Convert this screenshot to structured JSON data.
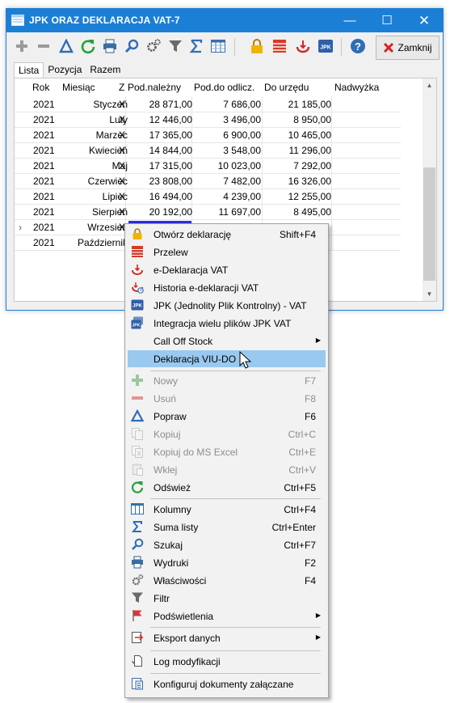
{
  "window": {
    "title": "JPK ORAZ DEKLARACJA VAT-7",
    "controls": {
      "minimize": "—",
      "maximize": "☐",
      "close": "✕"
    }
  },
  "toolbar": {
    "icons": [
      "add-icon",
      "remove-icon",
      "edit-icon",
      "refresh-icon",
      "print-icon",
      "search-icon",
      "settings-icon",
      "filter-icon",
      "sum-icon",
      "columns-icon",
      "lock-icon",
      "transfer-icon",
      "e-declaration-icon",
      "jpk-icon",
      "help-icon"
    ],
    "close_label": "Zamknij",
    "jpk_text": "JPK",
    "help_text": "?"
  },
  "tabs": [
    "Lista",
    "Pozycja",
    "Razem"
  ],
  "table": {
    "columns": [
      "Rok",
      "Miesiąc",
      "Z",
      "Pod.należny",
      "Pod.do odlicz.",
      "Do urzędu",
      "Nadwyżka"
    ],
    "rows": [
      {
        "marker": "",
        "rok": "2021",
        "miesiac": "Styczeń",
        "z": "X",
        "nalezny": "28 871,00",
        "odlicz": "7 686,00",
        "urzad": "21 185,00",
        "nadwyzka": ""
      },
      {
        "marker": "",
        "rok": "2021",
        "miesiac": "Luty",
        "z": "X",
        "nalezny": "12 446,00",
        "odlicz": "3 496,00",
        "urzad": "8 950,00",
        "nadwyzka": ""
      },
      {
        "marker": "",
        "rok": "2021",
        "miesiac": "Marzec",
        "z": "X",
        "nalezny": "17 365,00",
        "odlicz": "6 900,00",
        "urzad": "10 465,00",
        "nadwyzka": ""
      },
      {
        "marker": "",
        "rok": "2021",
        "miesiac": "Kwiecień",
        "z": "X",
        "nalezny": "14 844,00",
        "odlicz": "3 548,00",
        "urzad": "11 296,00",
        "nadwyzka": ""
      },
      {
        "marker": "",
        "rok": "2021",
        "miesiac": "Maj",
        "z": "X",
        "nalezny": "17 315,00",
        "odlicz": "10 023,00",
        "urzad": "7 292,00",
        "nadwyzka": ""
      },
      {
        "marker": "",
        "rok": "2021",
        "miesiac": "Czerwiec",
        "z": "X",
        "nalezny": "23 808,00",
        "odlicz": "7 482,00",
        "urzad": "16 326,00",
        "nadwyzka": ""
      },
      {
        "marker": "",
        "rok": "2021",
        "miesiac": "Lipiec",
        "z": "X",
        "nalezny": "16 494,00",
        "odlicz": "4 239,00",
        "urzad": "12 255,00",
        "nadwyzka": ""
      },
      {
        "marker": "",
        "rok": "2021",
        "miesiac": "Sierpień",
        "z": "X",
        "nalezny": "20 192,00",
        "odlicz": "11 697,00",
        "urzad": "8 495,00",
        "nadwyzka": ""
      },
      {
        "marker": "›",
        "rok": "2021",
        "miesiac": "Wrzesień",
        "z": "X",
        "nalezny": "",
        "odlicz": "",
        "urzad": "",
        "nadwyzka": ""
      },
      {
        "marker": "",
        "rok": "2021",
        "miesiac": "Październik",
        "z": "",
        "nalezny": "",
        "odlicz": "",
        "urzad": "",
        "nadwyzka": ""
      }
    ]
  },
  "context_menu": {
    "items": [
      {
        "label": "Otwórz deklarację",
        "shortcut": "Shift+F4",
        "icon": "lock-icon",
        "disabled": false
      },
      {
        "label": "Przelew",
        "shortcut": "",
        "icon": "transfer-icon",
        "disabled": false
      },
      {
        "label": "e-Deklaracja VAT",
        "shortcut": "",
        "icon": "e-declaration-icon",
        "disabled": false
      },
      {
        "label": "Historia e-deklaracji VAT",
        "shortcut": "",
        "icon": "e-declaration-history-icon",
        "disabled": false
      },
      {
        "label": "JPK (Jednolity Plik Kontrolny) - VAT",
        "shortcut": "",
        "icon": "jpk-icon",
        "disabled": false
      },
      {
        "label": "Integracja wielu plików JPK VAT",
        "shortcut": "",
        "icon": "jpk-integration-icon",
        "disabled": false
      },
      {
        "label": "Call Off Stock",
        "shortcut": "",
        "icon": "",
        "disabled": false,
        "submenu": true
      },
      {
        "label": "Deklaracja VIU-DO",
        "shortcut": "",
        "icon": "",
        "disabled": false,
        "highlighted": true
      },
      {
        "label": "Nowy",
        "shortcut": "F7",
        "icon": "add-icon",
        "disabled": true
      },
      {
        "label": "Usuń",
        "shortcut": "F8",
        "icon": "remove-icon",
        "disabled": true
      },
      {
        "label": "Popraw",
        "shortcut": "F6",
        "icon": "edit-icon",
        "disabled": false
      },
      {
        "label": "Kopiuj",
        "shortcut": "Ctrl+C",
        "icon": "copy-icon",
        "disabled": true
      },
      {
        "label": "Kopiuj do MS Excel",
        "shortcut": "Ctrl+E",
        "icon": "copy-excel-icon",
        "disabled": true
      },
      {
        "label": "Wklej",
        "shortcut": "Ctrl+V",
        "icon": "paste-icon",
        "disabled": true
      },
      {
        "label": "Odśwież",
        "shortcut": "Ctrl+F5",
        "icon": "refresh-icon",
        "disabled": false
      },
      {
        "label": "Kolumny",
        "shortcut": "Ctrl+F4",
        "icon": "columns-icon",
        "disabled": false
      },
      {
        "label": "Suma listy",
        "shortcut": "Ctrl+Enter",
        "icon": "sum-icon",
        "disabled": false
      },
      {
        "label": "Szukaj",
        "shortcut": "Ctrl+F7",
        "icon": "search-icon",
        "disabled": false
      },
      {
        "label": "Wydruki",
        "shortcut": "F2",
        "icon": "print-icon",
        "disabled": false
      },
      {
        "label": "Właściwości",
        "shortcut": "F4",
        "icon": "settings-icon",
        "disabled": false
      },
      {
        "label": "Filtr",
        "shortcut": "",
        "icon": "filter-icon",
        "disabled": false
      },
      {
        "label": "Podświetlenia",
        "shortcut": "",
        "icon": "highlight-flag-icon",
        "disabled": false,
        "submenu": true
      },
      {
        "label": "Eksport danych",
        "shortcut": "",
        "icon": "export-icon",
        "disabled": false,
        "submenu": true
      },
      {
        "label": "Log modyfikacji",
        "shortcut": "",
        "icon": "log-icon",
        "disabled": false
      },
      {
        "label": "Konfiguruj dokumenty załączane",
        "shortcut": "",
        "icon": "attachments-icon",
        "disabled": false
      }
    ]
  }
}
